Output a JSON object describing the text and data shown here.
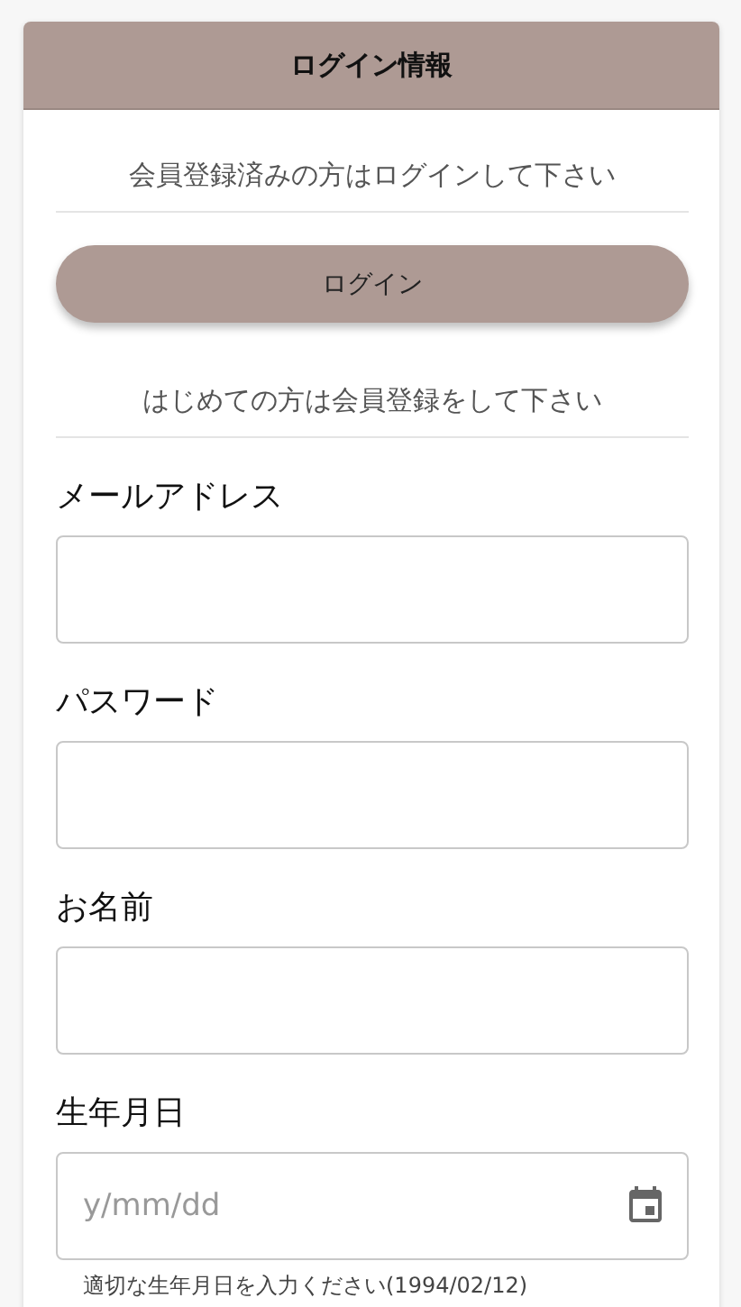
{
  "header": {
    "title": "ログイン情報"
  },
  "login_section": {
    "prompt": "会員登録済みの方はログインして下さい",
    "button": "ログイン"
  },
  "register_section": {
    "prompt": "はじめての方は会員登録をして下さい"
  },
  "fields": [
    {
      "kind": "text",
      "label": "メールアドレス"
    },
    {
      "kind": "text",
      "label": "パスワード"
    },
    {
      "kind": "text",
      "label": "お名前"
    },
    {
      "kind": "date",
      "label": "生年月日",
      "placeholder": "y/mm/dd",
      "hint": "適切な生年月日を入力ください(1994/02/12)"
    }
  ]
}
